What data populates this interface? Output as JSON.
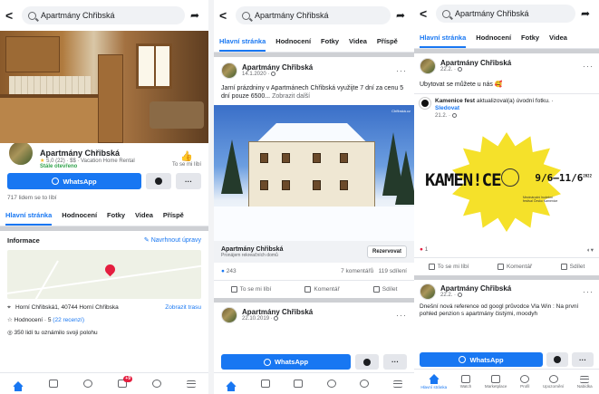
{
  "search_query": "Apartmány Chřibská",
  "page_name": "Apartmány Chřibská",
  "panel1": {
    "rating": "5,0 (22) · $$ · Vacation Home Rental",
    "open_status": "Stále otevřeno",
    "like_label": "To se mi líbí",
    "whatsapp": "WhatsApp",
    "more": "···",
    "likes_count": "717 lidem se to líbí",
    "tabs": [
      "Hlavní stránka",
      "Hodnocení",
      "Fotky",
      "Videa",
      "Příspě"
    ],
    "info_title": "Informace",
    "suggest_edit": "Navrhnout úpravy",
    "address": "Horní Chřibská1, 40744 Horní Chřibska",
    "route": "Zobrazit trasu",
    "rating_line": "Hodnocení · 5",
    "rating_link": "(22 recenzí)",
    "visits": "350 lidí tu oznámilo svoji polohu",
    "nav_badge": "+9"
  },
  "panel2": {
    "tabs": [
      "Hlavní stránka",
      "Hodnocení",
      "Fotky",
      "Videa",
      "Příspě"
    ],
    "post_date": "14.1.2020 ·",
    "post_text": "Jarní prázdniny v Apartmánech Chřibská využijte 7 dní za cenu 5 dní pouze 6500...",
    "see_more": "Zobrazit další",
    "watermark": "Chřibská.cz",
    "link_title": "Apartmány Chřibská",
    "link_sub": "Pronájem rekreačních domů",
    "reserve": "Rezervovat",
    "reactions": "243",
    "comments": "7 komentářů",
    "shares": "119 sdílení",
    "like": "To se mi líbí",
    "comment": "Komentář",
    "share": "Sdílet",
    "post2_date": "22.10.2019 ·",
    "whatsapp": "WhatsApp",
    "more": "···"
  },
  "panel3": {
    "tabs": [
      "Hlavní stránka",
      "Hodnocení",
      "Fotky",
      "Videa"
    ],
    "post_date": "22.2. ·",
    "post_text": "Ubytovat se můžete u nás 🥰",
    "shared_name": "Kamenice fest",
    "shared_action": "aktualizoval(a) úvodní fotku. ·",
    "follow": "Sledovat",
    "shared_date": "21.2. ·",
    "poster_title": "KAMEN!CE",
    "poster_date": "9/6–11/6",
    "poster_year": "2022",
    "poster_small": "Mezinárodní hudební festival Česko Kamenice",
    "reactions": "1",
    "like": "To se mi líbí",
    "comment": "Komentář",
    "share": "Sdílet",
    "post2_date": "22.2. ·",
    "post2_text": "Dnešní nová reference od googl průvodce Vla Win : Na první pohled penzion s apartmány čistými, moodyh",
    "whatsapp": "WhatsApp",
    "more": "···",
    "nav_labels": [
      "Hlavní stránka",
      "Watch",
      "Marketplace",
      "Profil",
      "Upozornění",
      "Nabídka"
    ]
  },
  "colors": {
    "accent": "#1877f2",
    "badge": "#e41e3f",
    "poster_yellow": "#f5e12a"
  }
}
